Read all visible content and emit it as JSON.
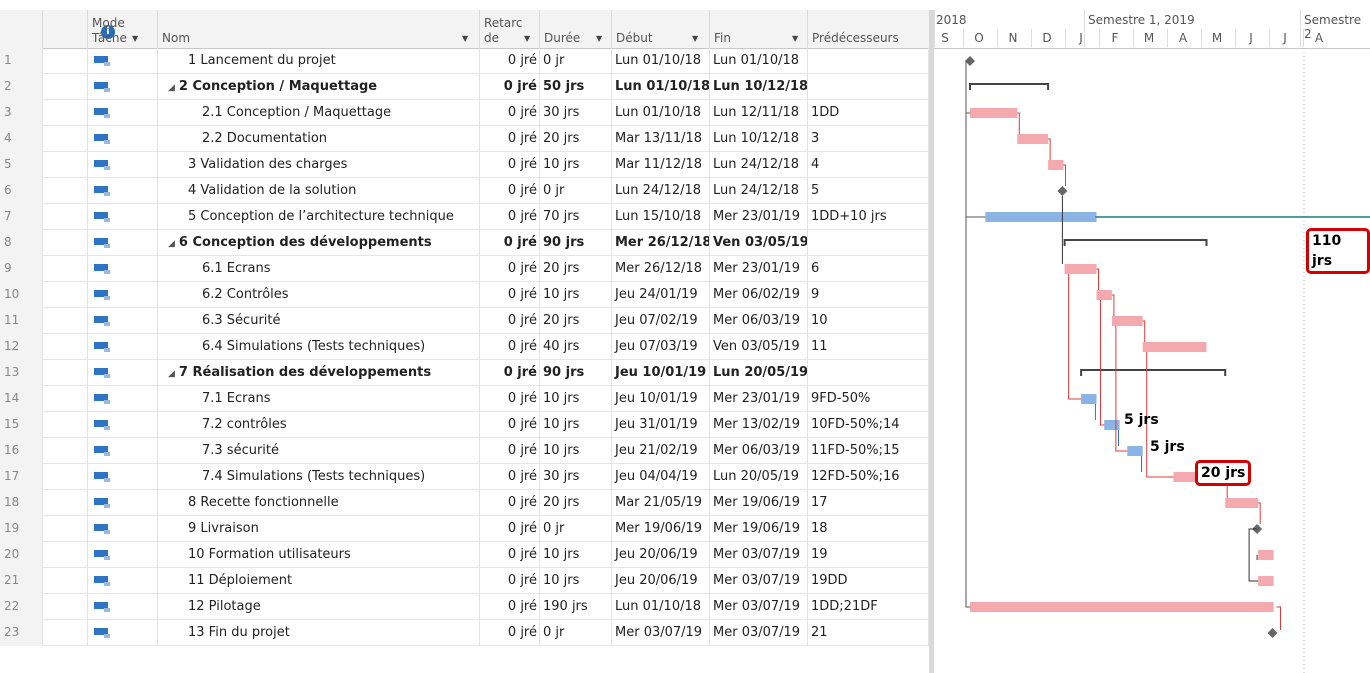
{
  "columns": {
    "mode_line1": "Mode",
    "mode_line2": "Tâche",
    "nom": "Nom",
    "retard_line1": "Retarc",
    "retard_line2": "de",
    "duree": "Durée",
    "debut": "Début",
    "fin": "Fin",
    "pred": "Prédécesseurs"
  },
  "tasks": [
    {
      "id": "1",
      "name": "1 Lancement du projet",
      "indent": 1,
      "summary": false,
      "retard": "0 jré",
      "duree": "0 jr",
      "debut": "Lun 01/10/18",
      "fin": "Lun 01/10/18",
      "pred": ""
    },
    {
      "id": "2",
      "name": "2 Conception / Maquettage",
      "indent": 0,
      "summary": true,
      "retard": "0 jré",
      "duree": "50 jrs",
      "debut": "Lun 01/10/18",
      "fin": "Lun 10/12/18",
      "pred": ""
    },
    {
      "id": "3",
      "name": "2.1 Conception / Maquettage",
      "indent": 2,
      "summary": false,
      "retard": "0 jré",
      "duree": "30 jrs",
      "debut": "Lun 01/10/18",
      "fin": "Lun 12/11/18",
      "pred": "1DD"
    },
    {
      "id": "4",
      "name": "2.2 Documentation",
      "indent": 2,
      "summary": false,
      "retard": "0 jré",
      "duree": "20 jrs",
      "debut": "Mar 13/11/18",
      "fin": "Lun 10/12/18",
      "pred": "3"
    },
    {
      "id": "5",
      "name": "3 Validation des charges",
      "indent": 1,
      "summary": false,
      "retard": "0 jré",
      "duree": "10 jrs",
      "debut": "Mar 11/12/18",
      "fin": "Lun 24/12/18",
      "pred": "4"
    },
    {
      "id": "6",
      "name": "4 Validation de la solution",
      "indent": 1,
      "summary": false,
      "retard": "0 jré",
      "duree": "0 jr",
      "debut": "Lun 24/12/18",
      "fin": "Lun 24/12/18",
      "pred": "5"
    },
    {
      "id": "7",
      "name": "5 Conception de l’architecture technique",
      "indent": 1,
      "summary": false,
      "retard": "0 jré",
      "duree": "70 jrs",
      "debut": "Lun 15/10/18",
      "fin": "Mer 23/01/19",
      "pred": "1DD+10 jrs"
    },
    {
      "id": "8",
      "name": "6 Conception des développements",
      "indent": 0,
      "summary": true,
      "retard": "0 jré",
      "duree": "90 jrs",
      "debut": "Mer 26/12/18",
      "fin": "Ven 03/05/19",
      "pred": ""
    },
    {
      "id": "9",
      "name": "6.1 Ecrans",
      "indent": 2,
      "summary": false,
      "retard": "0 jré",
      "duree": "20 jrs",
      "debut": "Mer 26/12/18",
      "fin": "Mer 23/01/19",
      "pred": "6"
    },
    {
      "id": "10",
      "name": "6.2 Contrôles",
      "indent": 2,
      "summary": false,
      "retard": "0 jré",
      "duree": "10 jrs",
      "debut": "Jeu 24/01/19",
      "fin": "Mer 06/02/19",
      "pred": "9"
    },
    {
      "id": "11",
      "name": "6.3 Sécurité",
      "indent": 2,
      "summary": false,
      "retard": "0 jré",
      "duree": "20 jrs",
      "debut": "Jeu 07/02/19",
      "fin": "Mer 06/03/19",
      "pred": "10"
    },
    {
      "id": "12",
      "name": "6.4 Simulations (Tests techniques)",
      "indent": 2,
      "summary": false,
      "retard": "0 jré",
      "duree": "40 jrs",
      "debut": "Jeu 07/03/19",
      "fin": "Ven 03/05/19",
      "pred": "11"
    },
    {
      "id": "13",
      "name": "7 Réalisation des développements",
      "indent": 0,
      "summary": true,
      "retard": "0 jré",
      "duree": "90 jrs",
      "debut": "Jeu 10/01/19",
      "fin": "Lun 20/05/19",
      "pred": ""
    },
    {
      "id": "14",
      "name": "7.1 Ecrans",
      "indent": 2,
      "summary": false,
      "retard": "0 jré",
      "duree": "10 jrs",
      "debut": "Jeu 10/01/19",
      "fin": "Mer 23/01/19",
      "pred": "9FD-50%"
    },
    {
      "id": "15",
      "name": "7.2 contrôles",
      "indent": 2,
      "summary": false,
      "retard": "0 jré",
      "duree": "10 jrs",
      "debut": "Jeu 31/01/19",
      "fin": "Mer 13/02/19",
      "pred": "10FD-50%;14"
    },
    {
      "id": "16",
      "name": "7.3 sécurité",
      "indent": 2,
      "summary": false,
      "retard": "0 jré",
      "duree": "10 jrs",
      "debut": "Jeu 21/02/19",
      "fin": "Mer 06/03/19",
      "pred": "11FD-50%;15"
    },
    {
      "id": "17",
      "name": "7.4 Simulations (Tests techniques)",
      "indent": 2,
      "summary": false,
      "retard": "0 jré",
      "duree": "30 jrs",
      "debut": "Jeu 04/04/19",
      "fin": "Lun 20/05/19",
      "pred": "12FD-50%;16"
    },
    {
      "id": "18",
      "name": "8 Recette fonctionnelle",
      "indent": 1,
      "summary": false,
      "retard": "0 jré",
      "duree": "20 jrs",
      "debut": "Mar 21/05/19",
      "fin": "Mer 19/06/19",
      "pred": "17"
    },
    {
      "id": "19",
      "name": "9 Livraison",
      "indent": 1,
      "summary": false,
      "retard": "0 jré",
      "duree": "0 jr",
      "debut": "Mer 19/06/19",
      "fin": "Mer 19/06/19",
      "pred": "18"
    },
    {
      "id": "20",
      "name": "10 Formation utilisateurs",
      "indent": 1,
      "summary": false,
      "retard": "0 jré",
      "duree": "10 jrs",
      "debut": "Jeu 20/06/19",
      "fin": "Mer 03/07/19",
      "pred": "19"
    },
    {
      "id": "21",
      "name": "11 Déploiement",
      "indent": 1,
      "summary": false,
      "retard": "0 jré",
      "duree": "10 jrs",
      "debut": "Jeu 20/06/19",
      "fin": "Mer 03/07/19",
      "pred": "19DD"
    },
    {
      "id": "22",
      "name": "12 Pilotage",
      "indent": 1,
      "summary": false,
      "retard": "0 jré",
      "duree": "190 jrs",
      "debut": "Lun 01/10/18",
      "fin": "Mer 03/07/19",
      "pred": "1DD;21DF"
    },
    {
      "id": "23",
      "name": "13 Fin du projet",
      "indent": 1,
      "summary": false,
      "retard": "0 jré",
      "duree": "0 jr",
      "debut": "Mer 03/07/19",
      "fin": "Mer 03/07/19",
      "pred": "21"
    }
  ],
  "timescale": {
    "years": [
      {
        "label": "2018"
      },
      {
        "label": "Semestre 1, 2019"
      },
      {
        "label": "Semestre 2"
      }
    ],
    "months": [
      "S",
      "O",
      "N",
      "D",
      "J",
      "F",
      "M",
      "A",
      "M",
      "J",
      "J",
      "A"
    ]
  },
  "callouts": {
    "c110": "110 jrs",
    "c20": "20 jrs",
    "l5a": "5 jrs",
    "l5b": "5 jrs"
  },
  "colors": {
    "critical": "#f4a9ae",
    "normal": "#8ab4e6",
    "summary": "#444444",
    "link_critical": "#e03a3a",
    "link_normal": "#2f73c5",
    "slack": "#1f7a7a",
    "callout_border": "#d20000"
  }
}
